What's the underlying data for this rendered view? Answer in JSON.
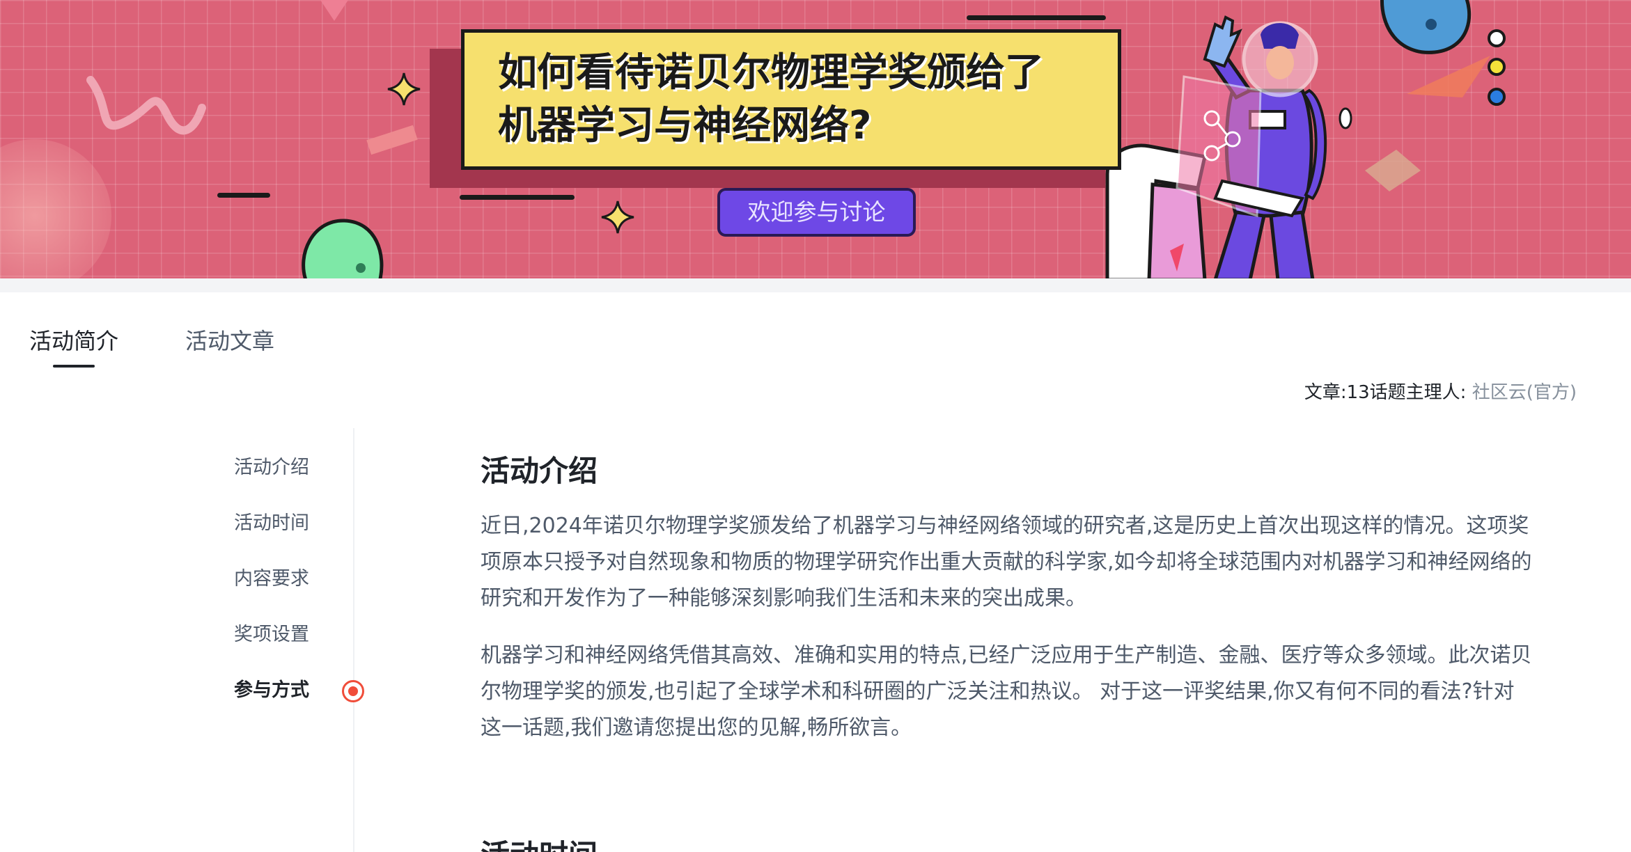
{
  "banner": {
    "title_line1": "如何看待诺贝尔物理学奖颁给了",
    "title_line2": "机器学习与神经网络?",
    "cta_label": "欢迎参与讨论",
    "colors": {
      "background": "#dc6278",
      "card": "#f6e06e",
      "button": "#6e48e6"
    }
  },
  "tabs": [
    {
      "label": "活动简介",
      "active": true
    },
    {
      "label": "活动文章",
      "active": false
    }
  ],
  "meta": {
    "articles_label": "文章:",
    "articles_count": "13",
    "host_label": "话题主理人:",
    "host_name": "社区云(官方)"
  },
  "side_nav": {
    "items": [
      {
        "label": "活动介绍",
        "active": false
      },
      {
        "label": "活动时间",
        "active": false
      },
      {
        "label": "内容要求",
        "active": false
      },
      {
        "label": "奖项设置",
        "active": false
      },
      {
        "label": "参与方式",
        "active": true
      }
    ],
    "marker_color": "#f04d3a"
  },
  "content": {
    "section1_title": "活动介绍",
    "paragraphs": [
      "近日,2024年诺贝尔物理学奖颁发给了机器学习与神经网络领域的研究者,这是历史上首次出现这样的情况。这项奖项原本只授予对自然现象和物质的物理学研究作出重大贡献的科学家,如今却将全球范围内对机器学习和神经网络的研究和开发作为了一种能够深刻影响我们生活和未来的突出成果。",
      "机器学习和神经网络凭借其高效、准确和实用的特点,已经广泛应用于生产制造、金融、医疗等众多领域。此次诺贝尔物理学奖的颁发,也引起了全球学术和科研圈的广泛关注和热议。 对于这一评奖结果,你又有何不同的看法?针对这一话题,我们邀请您提出您的见解,畅所欲言。"
    ],
    "section2_title": "活动时间"
  }
}
